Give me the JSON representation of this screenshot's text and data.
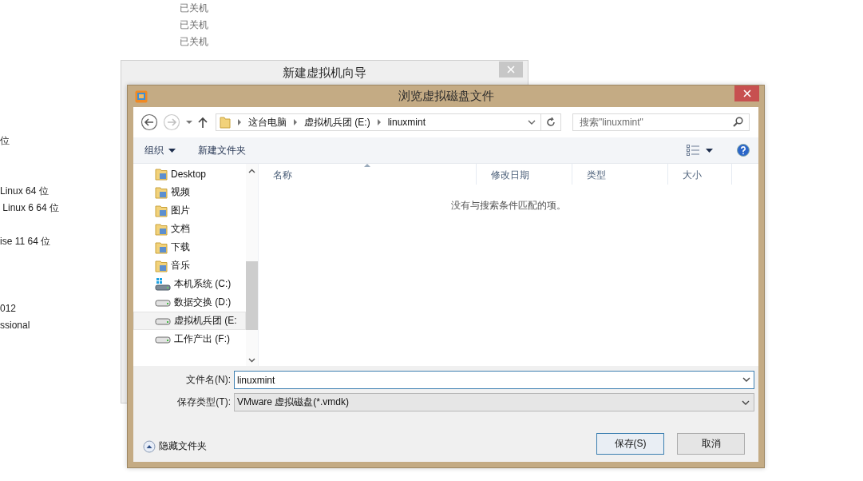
{
  "background_list": {
    "status_texts": [
      "已关机",
      "已关机",
      "已关机"
    ],
    "name_texts": [
      "位",
      "Linux 64 位",
      " Linux 6 64 位",
      "ise 11 64 位",
      "012",
      "ssional"
    ]
  },
  "wizard_window": {
    "title": "新建虚拟机向导"
  },
  "dialog": {
    "title": "浏览虚拟磁盘文件",
    "breadcrumb": [
      "这台电脑",
      "虚拟机兵团 (E:)",
      "linuxmint"
    ],
    "search": {
      "placeholder": "搜索\"linuxmint\""
    },
    "toolbar": [
      {
        "label": "组织",
        "kind": "menu"
      },
      {
        "label": "新建文件夹",
        "kind": "plain"
      }
    ],
    "nav_items": [
      {
        "label": "Desktop",
        "kind": "folder",
        "selected": false
      },
      {
        "label": "视频",
        "kind": "folder",
        "selected": false
      },
      {
        "label": "图片",
        "kind": "folder",
        "selected": false
      },
      {
        "label": "文档",
        "kind": "folder",
        "selected": false
      },
      {
        "label": "下载",
        "kind": "folder",
        "selected": false
      },
      {
        "label": "音乐",
        "kind": "folder",
        "selected": false
      },
      {
        "label": "本机系统 (C:)",
        "kind": "system-drive",
        "selected": false
      },
      {
        "label": "数据交换 (D:)",
        "kind": "drive",
        "selected": false
      },
      {
        "label": "虚拟机兵团 (E:",
        "kind": "drive",
        "selected": true
      },
      {
        "label": "工作产出 (F:)",
        "kind": "drive",
        "selected": false
      }
    ],
    "columns": [
      {
        "label": "名称",
        "sorted": true
      },
      {
        "label": "修改日期",
        "sorted": false
      },
      {
        "label": "类型",
        "sorted": false
      },
      {
        "label": "大小",
        "sorted": false
      }
    ],
    "empty_message": "没有与搜索条件匹配的项。",
    "file_name": {
      "label": "文件名(N):",
      "value": "linuxmint"
    },
    "file_type": {
      "label": "保存类型(T):",
      "value": "VMware 虚拟磁盘(*.vmdk)"
    },
    "hide_folders": "隐藏文件夹",
    "buttons": [
      {
        "label": "保存(S)",
        "default": true
      },
      {
        "label": "取消",
        "default": false
      }
    ]
  }
}
